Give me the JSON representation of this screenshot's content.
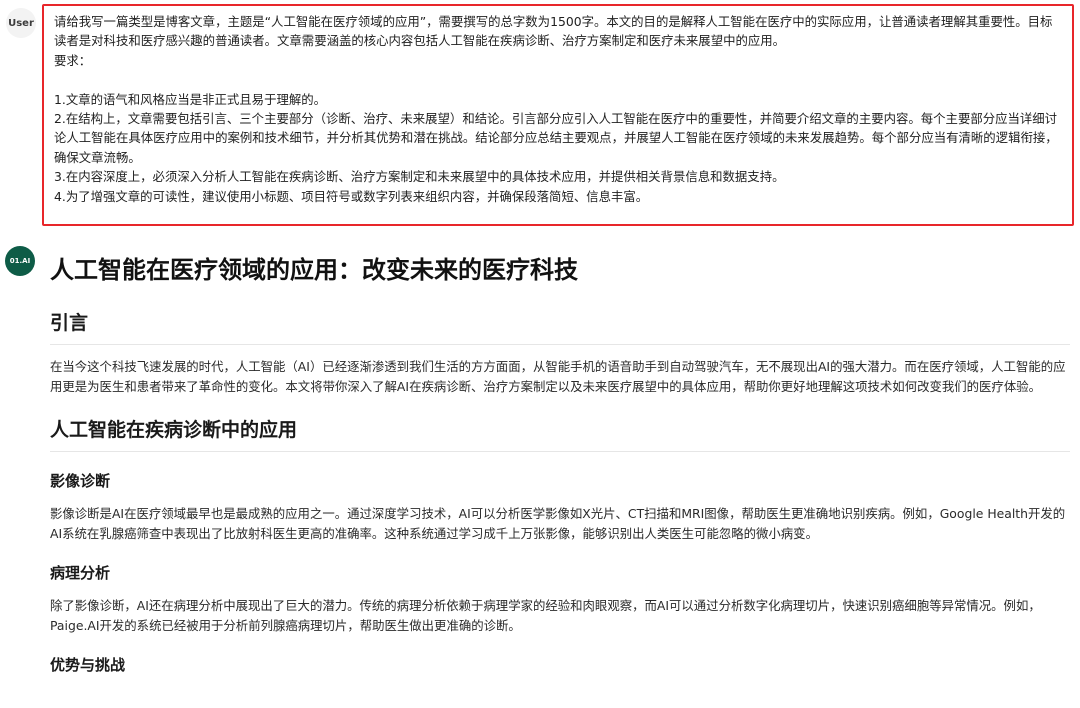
{
  "user": {
    "avatar_label": "User",
    "message": "请给我写一篇类型是博客文章，主题是“人工智能在医疗领域的应用”，需要撰写的总字数为1500字。本文的目的是解释人工智能在医疗中的实际应用，让普通读者理解其重要性。目标读者是对科技和医疗感兴趣的普通读者。文章需要涵盖的核心内容包括人工智能在疾病诊断、治疗方案制定和医疗未来展望中的应用。\n要求：\n\n1.文章的语气和风格应当是非正式且易于理解的。\n2.在结构上，文章需要包括引言、三个主要部分（诊断、治疗、未来展望）和结论。引言部分应引入人工智能在医疗中的重要性，并简要介绍文章的主要内容。每个主要部分应当详细讨论人工智能在具体医疗应用中的案例和技术细节，并分析其优势和潜在挑战。结论部分应总结主要观点，并展望人工智能在医疗领域的未来发展趋势。每个部分应当有清晰的逻辑衔接，确保文章流畅。\n3.在内容深度上，必须深入分析人工智能在疾病诊断、治疗方案制定和未来展望中的具体技术应用，并提供相关背景信息和数据支持。\n4.为了增强文章的可读性，建议使用小标题、项目符号或数字列表来组织内容，并确保段落简短、信息丰富。"
  },
  "assistant": {
    "avatar_label": "01.AI",
    "title": "人工智能在医疗领域的应用：改变未来的医疗科技",
    "intro_heading": "引言",
    "intro_text": "在当今这个科技飞速发展的时代，人工智能（AI）已经逐渐渗透到我们生活的方方面面，从智能手机的语音助手到自动驾驶汽车，无不展现出AI的强大潜力。而在医疗领域，人工智能的应用更是为医生和患者带来了革命性的变化。本文将带你深入了解AI在疾病诊断、治疗方案制定以及未来医疗展望中的具体应用，帮助你更好地理解这项技术如何改变我们的医疗体验。",
    "diagnosis_heading": "人工智能在疾病诊断中的应用",
    "imaging_heading": "影像诊断",
    "imaging_text": "影像诊断是AI在医疗领域最早也是最成熟的应用之一。通过深度学习技术，AI可以分析医学影像如X光片、CT扫描和MRI图像，帮助医生更准确地识别疾病。例如，Google Health开发的AI系统在乳腺癌筛查中表现出了比放射科医生更高的准确率。这种系统通过学习成千上万张影像，能够识别出人类医生可能忽略的微小病变。",
    "pathology_heading": "病理分析",
    "pathology_text": "除了影像诊断，AI还在病理分析中展现出了巨大的潜力。传统的病理分析依赖于病理学家的经验和肉眼观察，而AI可以通过分析数字化病理切片，快速识别癌细胞等异常情况。例如，Paige.AI开发的系统已经被用于分析前列腺癌病理切片，帮助医生做出更准确的诊断。",
    "pros_cons_heading": "优势与挑战"
  }
}
